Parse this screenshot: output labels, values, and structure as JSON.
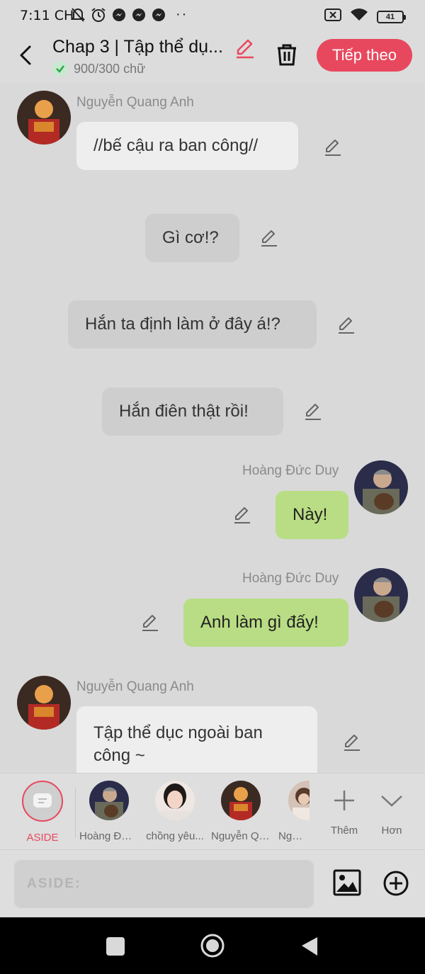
{
  "status_bar": {
    "time": "7:11 CH",
    "battery": "41"
  },
  "header": {
    "title": "Chap 3 | Tập thể dụ...",
    "word_count": "900/300 chữ",
    "next_button": "Tiếp theo"
  },
  "messages": [
    {
      "sender": "Nguyễn Quang Anh",
      "text": "//bế cậu ra ban công//"
    },
    {
      "text": "Gì cơ!?"
    },
    {
      "text": "Hắn ta định làm ở đây á!?"
    },
    {
      "text": "Hắn điên thật rồi!"
    },
    {
      "sender": "Hoàng Đức Duy",
      "text": "Này!"
    },
    {
      "sender": "Hoàng Đức Duy",
      "text": "Anh làm gì đấy!"
    },
    {
      "sender": "Nguyễn Quang Anh",
      "text": "Tập thể dục ngoài ban công ~"
    }
  ],
  "character_bar": {
    "aside": "ASIDE",
    "characters": [
      "Hoàng Đức Duy",
      "chồng yêu...",
      "Nguyễn Quang Anh",
      "Nguyễn..."
    ],
    "add_label": "Thêm",
    "more_label": "Hơn"
  },
  "input": {
    "placeholder": "ASIDE:"
  },
  "colors": {
    "accent": "#e8485e",
    "my_bubble": "#b9dd84",
    "background": "#d9d9d9"
  }
}
